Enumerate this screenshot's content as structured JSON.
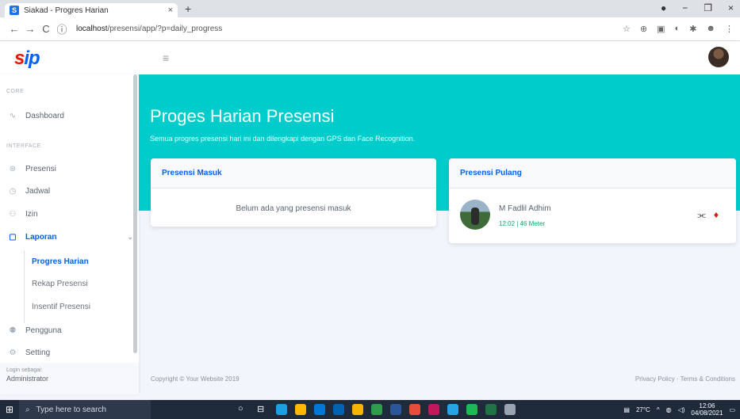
{
  "browser": {
    "tab_title": "Siakad - Progres Harian",
    "favicon_letter": "S",
    "url_host": "localhost",
    "url_path": "/presensi/app/?p=daily_progress"
  },
  "app": {
    "logo_main": "s",
    "logo_accent": "ip"
  },
  "sidebar": {
    "section_core": "CORE",
    "dashboard": "Dashboard",
    "section_interface": "INTERFACE",
    "presensi": "Presensi",
    "jadwal": "Jadwal",
    "izin": "Izin",
    "laporan": "Laporan",
    "sub_progres": "Progres Harian",
    "sub_rekap": "Rekap Presensi",
    "sub_insentif": "Insentif Presensi",
    "pengguna": "Pengguna",
    "setting": "Setting",
    "login_label": "Login sebagai:",
    "login_value": "Administrator"
  },
  "header": {
    "title": "Proges Harian Presensi",
    "subtitle": "Semua progres presensi hari ini dan dilengkapi dengan GPS dan Face Recognition."
  },
  "masuk": {
    "title": "Presensi Masuk",
    "empty": "Belum ada yang presensi masuk"
  },
  "pulang": {
    "title": "Presensi Pulang",
    "name": "M Fadlil Adhim",
    "meta": "12:02 | 46 Meter"
  },
  "footer": {
    "copyright": "Copyright © Your Website 2019",
    "links": "Privacy Policy · Terms & Conditions"
  },
  "taskbar": {
    "search_placeholder": "Type here to search",
    "temp": "27°C",
    "time": "12:06",
    "date": "04/08/2021"
  },
  "colors": {
    "primary": "#0061f2",
    "hero": "#00cccc",
    "success": "#00ac69",
    "danger": "#e81500"
  }
}
